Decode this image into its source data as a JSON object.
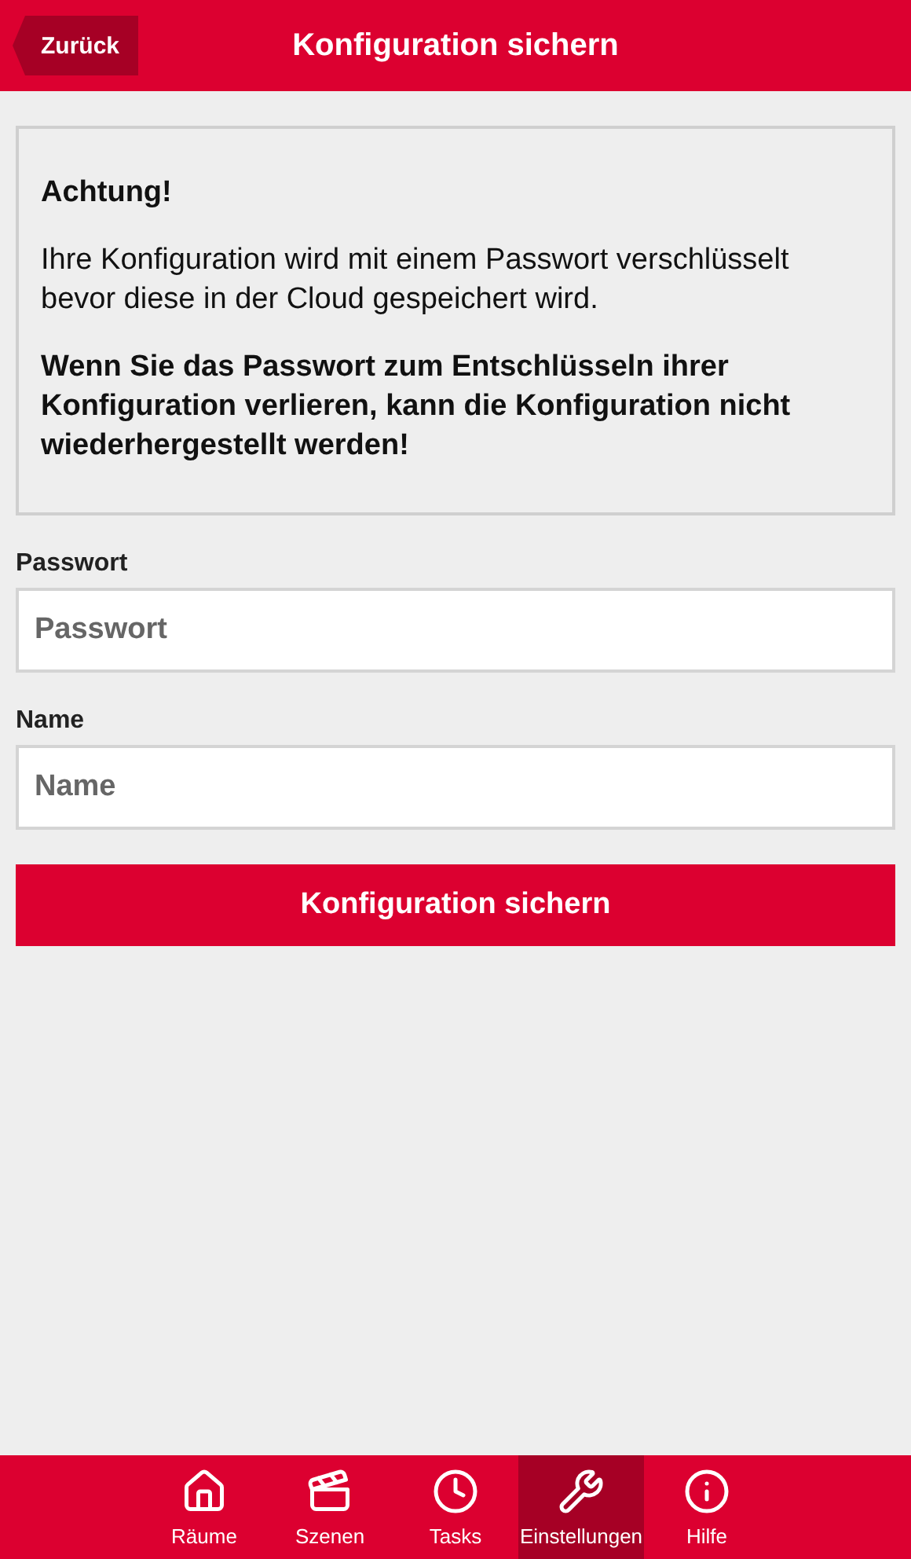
{
  "header": {
    "back": "Zurück",
    "title": "Konfiguration sichern"
  },
  "notice": [
    {
      "kind": "bold",
      "text": "Achtung!"
    },
    {
      "kind": "normal",
      "text": "Ihre Konfiguration wird mit einem Passwort verschlüsselt bevor diese in der Cloud gespeichert wird."
    },
    {
      "kind": "bold",
      "text": "Wenn Sie das Passwort zum Entschlüsseln ihrer Konfiguration verlieren, kann die Konfiguration nicht wiederhergestellt werden!"
    }
  ],
  "fields": [
    {
      "label": "Passwort",
      "placeholder": "Passwort"
    },
    {
      "label": "Name",
      "placeholder": "Name"
    }
  ],
  "submit": "Konfiguration sichern",
  "tabs": [
    {
      "label": "Räume",
      "selected": false
    },
    {
      "label": "Szenen",
      "selected": false
    },
    {
      "label": "Tasks",
      "selected": false
    },
    {
      "label": "Einstellungen",
      "selected": true
    },
    {
      "label": "Hilfe",
      "selected": false
    }
  ]
}
